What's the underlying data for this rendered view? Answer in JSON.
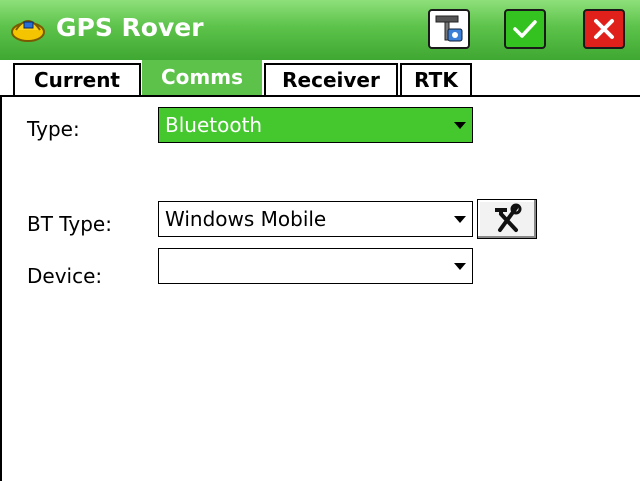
{
  "window": {
    "title": "GPS Rover",
    "buttons": {
      "config": "configure-icon",
      "ok": "checkmark-icon",
      "close": "close-icon"
    }
  },
  "tabs": [
    {
      "label": "Current",
      "active": false
    },
    {
      "label": "Comms",
      "active": true
    },
    {
      "label": "Receiver",
      "active": false
    },
    {
      "label": "RTK",
      "active": false
    }
  ],
  "form": {
    "type_label": "Type:",
    "type_value": "Bluetooth",
    "bt_type_label": "BT Type:",
    "bt_type_value": "Windows Mobile",
    "device_label": "Device:",
    "device_value": ""
  },
  "colors": {
    "title_bar": "#5cc24a",
    "active_tab": "#5cc24a",
    "selected_dropdown": "#45c82e",
    "close_button": "#e0201a",
    "ok_button": "#33c220"
  }
}
